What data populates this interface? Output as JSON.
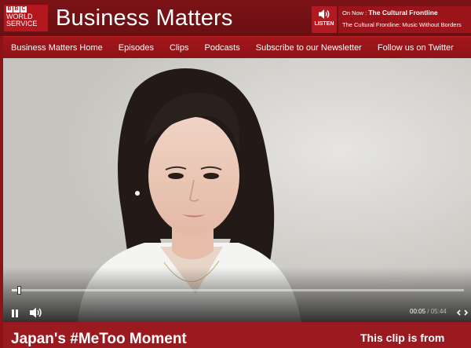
{
  "brand": {
    "logo_letters": [
      "B",
      "B",
      "C"
    ],
    "logo_line1": "WORLD",
    "logo_line2": "SERVICE",
    "title": "Business Matters"
  },
  "listen": {
    "label": "LISTEN",
    "icon": "speaker-icon",
    "on_now_prefix": "On Now :",
    "on_now_title": "The Cultural Frontline",
    "on_now_subtitle": "The Cultural Frontline: Music Without Borders"
  },
  "nav": {
    "items": [
      "Business Matters Home",
      "Episodes",
      "Clips",
      "Podcasts",
      "Subscribe to our Newsletter",
      "Follow us on Twitter"
    ]
  },
  "player": {
    "current_time": "00:05",
    "separator": "/",
    "duration": "05:44",
    "progress": 0.015,
    "play_icon": "pause-icon",
    "volume_icon": "volume-icon",
    "expand_icon": "expand-icon"
  },
  "bottom": {
    "story_title": "Japan's #MeToo Moment",
    "clip_from": "This clip is from"
  },
  "colors": {
    "header_bg": "#7c1317",
    "nav_bg": "#a3171c",
    "accent": "#b01a20"
  }
}
